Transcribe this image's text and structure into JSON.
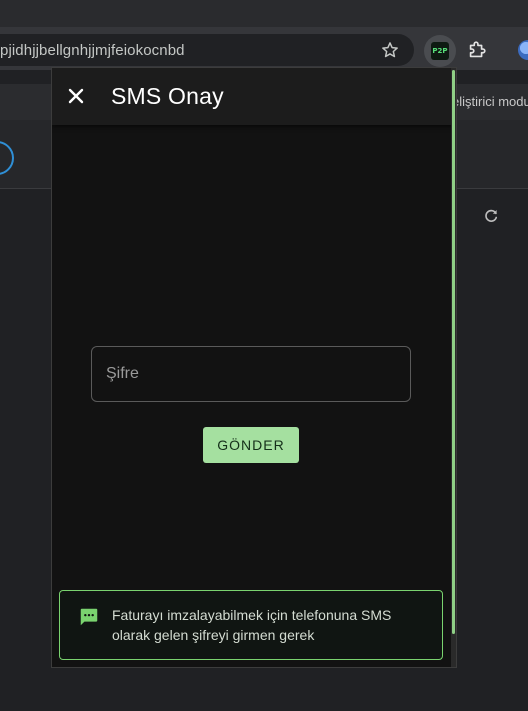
{
  "browser": {
    "address_text": "pjidhjjbellgnhjjmjfeiokocnbd",
    "extension_badge": "P2P",
    "page_bar_text": "eliştirici modu"
  },
  "popup": {
    "title": "SMS Onay",
    "password_placeholder": "Şifre",
    "password_value": "",
    "send_label": "GÖNDER",
    "info_message": "Faturayı imzalayabilmek için telefonuna SMS olarak gelen şifreyi girmen gerek"
  },
  "icons": {
    "close": "close-icon",
    "star": "star-icon",
    "extensions": "puzzle-icon",
    "reload": "reload-icon",
    "message": "message-icon"
  },
  "colors": {
    "accent": "#a5e0a0",
    "alert_border": "#7ad36f",
    "popup_bg": "#121212"
  }
}
